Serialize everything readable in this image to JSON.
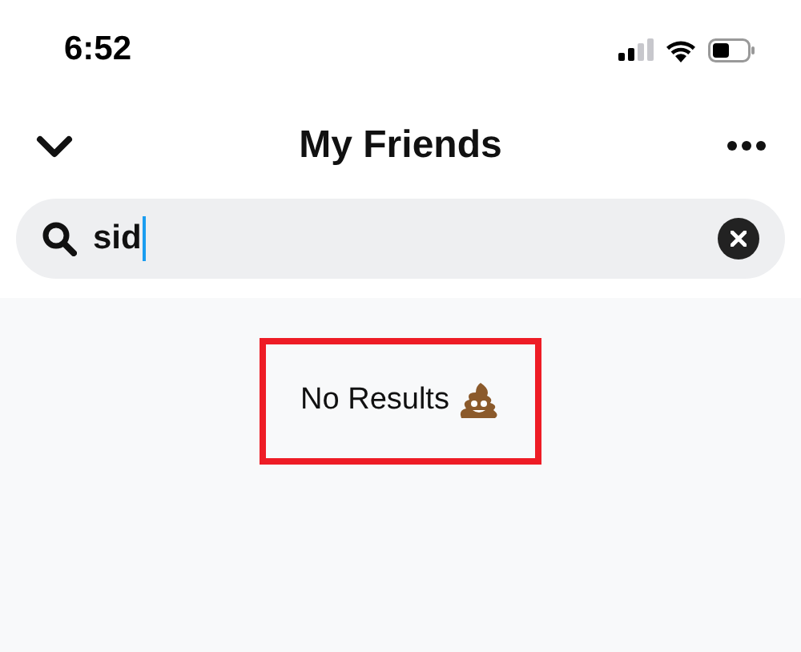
{
  "status_bar": {
    "time": "6:52"
  },
  "header": {
    "title": "My Friends"
  },
  "search": {
    "value": "sid",
    "focused": true
  },
  "results": {
    "message": "No Results",
    "highlighted": true
  }
}
